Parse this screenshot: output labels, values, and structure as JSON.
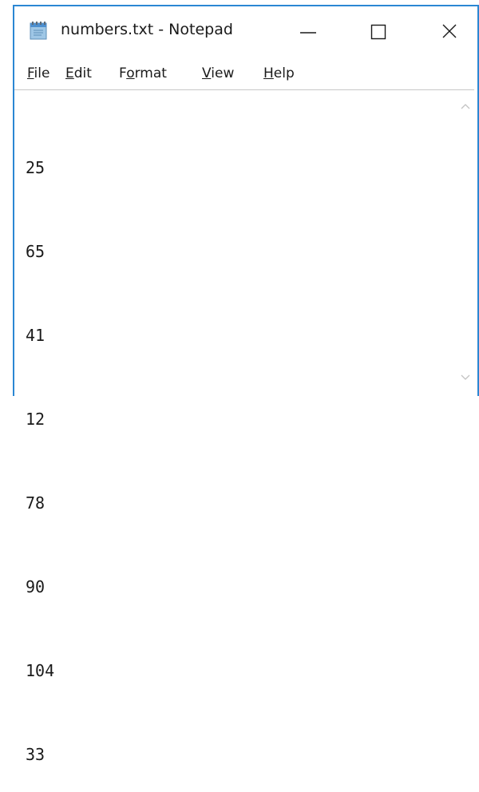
{
  "window": {
    "title": "numbers.txt - Notepad",
    "accent_color": "#2b87d3"
  },
  "title_controls": {
    "minimize_icon": "minimize-icon",
    "maximize_icon": "maximize-icon",
    "close_icon": "close-icon"
  },
  "menu": {
    "items": [
      {
        "label": "File",
        "mnemonic": "F"
      },
      {
        "label": "Edit",
        "mnemonic": "E"
      },
      {
        "label": "Format",
        "mnemonic": "o"
      },
      {
        "label": "View",
        "mnemonic": "V"
      },
      {
        "label": "Help",
        "mnemonic": "H"
      }
    ]
  },
  "editor": {
    "lines": [
      "25",
      "65",
      "41",
      "12",
      "78",
      "90",
      "104",
      "33"
    ]
  }
}
